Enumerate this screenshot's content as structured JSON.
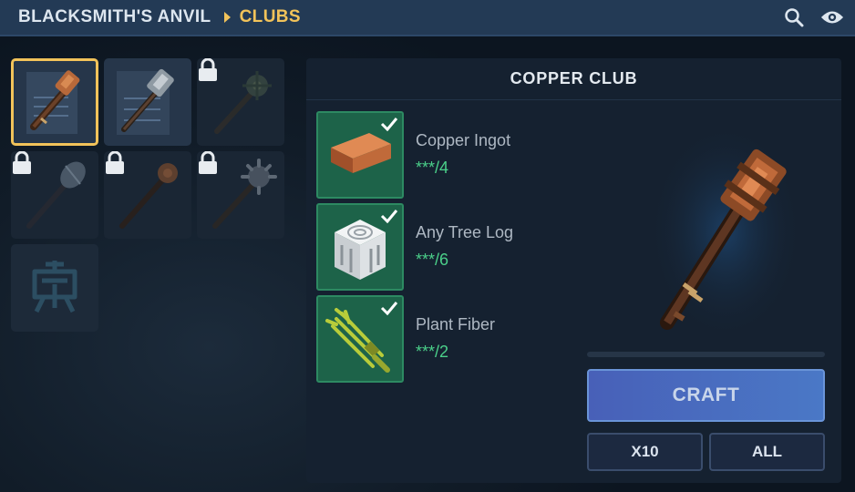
{
  "header": {
    "breadcrumb": [
      "BLACKSMITH'S ANVIL",
      "CLUBS"
    ],
    "search_icon": "search-icon",
    "visibility_icon": "eye-icon"
  },
  "recipe_grid": {
    "slots": [
      {
        "item": "copper-club",
        "state": "selected"
      },
      {
        "item": "iron-club",
        "state": "unlocked-recipe"
      },
      {
        "item": "spiked-club",
        "state": "locked"
      },
      {
        "item": "iron-mace",
        "state": "locked"
      },
      {
        "item": "wooden-club",
        "state": "locked"
      },
      {
        "item": "morning-star",
        "state": "locked"
      },
      {
        "item": "rune-emblem",
        "state": "unknown"
      }
    ]
  },
  "detail": {
    "title": "COPPER CLUB",
    "ingredients": [
      {
        "name": "Copper Ingot",
        "quantity": "***/4",
        "icon": "copper-ingot-icon",
        "available": true
      },
      {
        "name": "Any Tree Log",
        "quantity": "***/6",
        "icon": "tree-log-icon",
        "available": true
      },
      {
        "name": "Plant Fiber",
        "quantity": "***/2",
        "icon": "plant-fiber-icon",
        "available": true
      }
    ],
    "preview_icon": "copper-club-icon",
    "progress": 0,
    "craft_label": "CRAFT",
    "x10_label": "X10",
    "all_label": "ALL"
  },
  "colors": {
    "accent": "#f2c35a",
    "available": "#4bd08a",
    "craft_button": "#4a6ec0",
    "header": "#233a55"
  }
}
